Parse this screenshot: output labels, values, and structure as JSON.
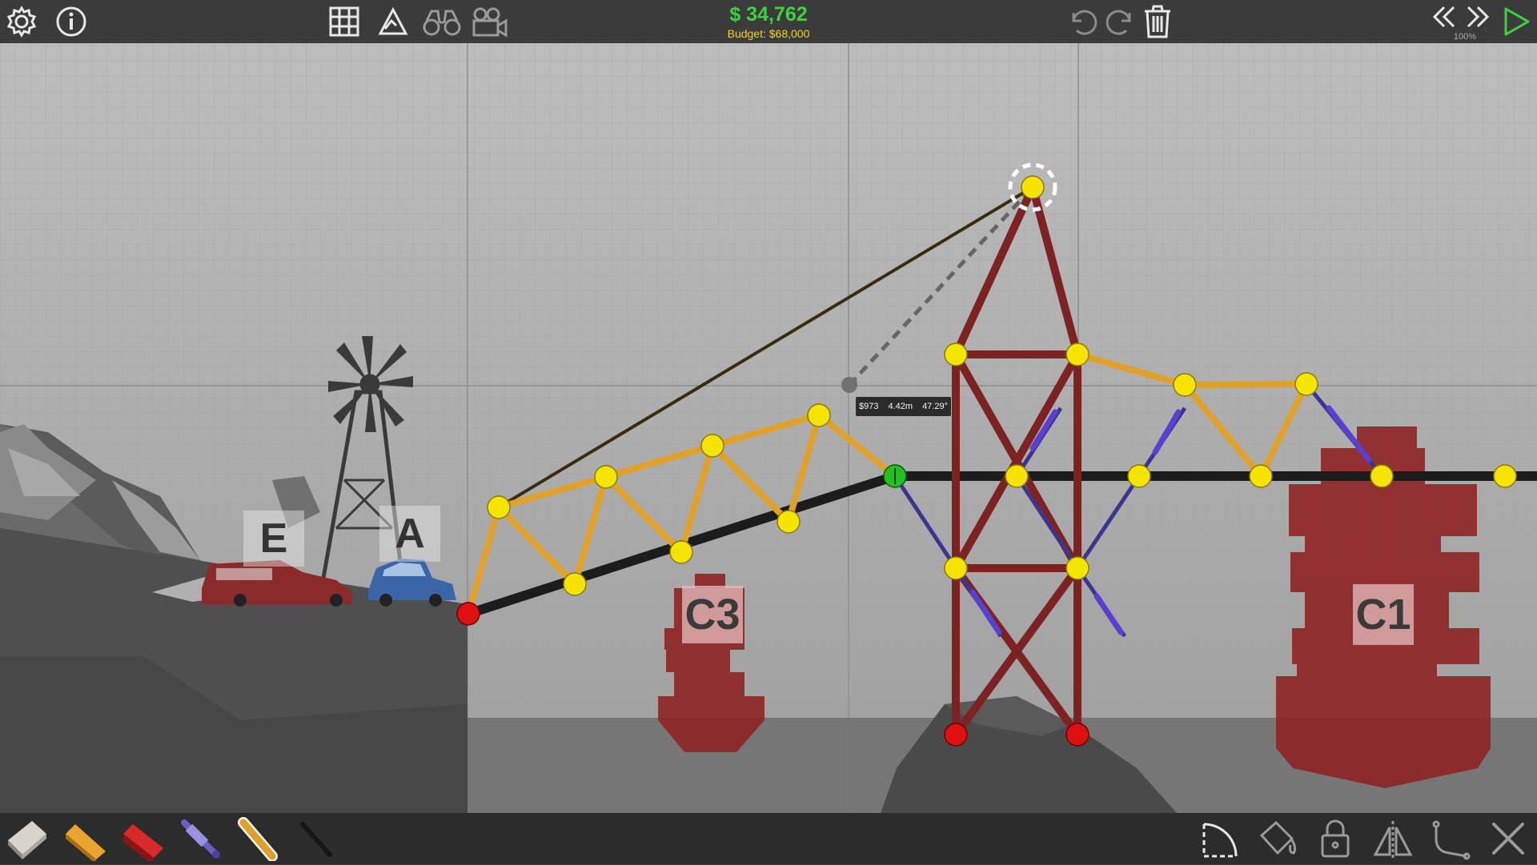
{
  "toolbar": {
    "left_icons": [
      "settings-icon",
      "info-icon"
    ],
    "center_icons": [
      "grid-icon",
      "stress-view-icon",
      "binoculars-icon",
      "camera-icon"
    ],
    "right_icons": [
      "undo-icon",
      "redo-icon",
      "trash-icon"
    ],
    "playback_icons": [
      "rewind-icon",
      "fast-forward-icon",
      "play-icon"
    ]
  },
  "cost": {
    "current": "$ 34,762",
    "budget": "Budget: $68,000",
    "current_color": "#3fd13f",
    "budget_color": "#f2d22b"
  },
  "speed": "100%",
  "tooltip": {
    "price": "$973",
    "length": "4.42m",
    "angle": "47.29°"
  },
  "vehicles": {
    "label_e": "E",
    "label_a": "A"
  },
  "checkpoints": {
    "c3": "C3",
    "c1": "C1"
  },
  "materials": [
    "road-material-icon",
    "wood-material-icon",
    "steel-material-icon",
    "hydraulic-material-icon",
    "rope-material-icon",
    "cable-material-icon"
  ],
  "edit_tools": [
    "arc-tool-icon",
    "paint-bucket-icon",
    "lock-icon",
    "mirror-icon",
    "curve-tool-icon",
    "close-icon"
  ],
  "colors": {
    "road": "#1c1c1c",
    "wood": "#e0a12a",
    "steel": "#8a2a2a",
    "hydraulic": "#5a3fd0",
    "joint": "#f5e400",
    "anchor": "#e01010",
    "selected_joint": "#22c020"
  }
}
